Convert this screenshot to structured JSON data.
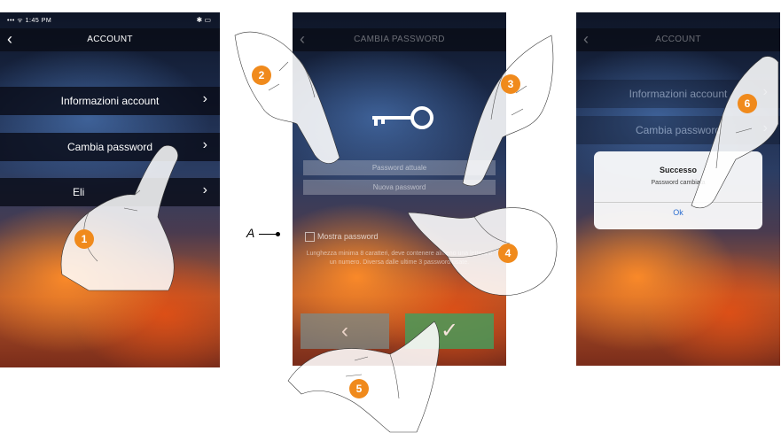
{
  "screen1": {
    "status_time": "1:45 PM",
    "status_left": "••• ᯤ",
    "status_right": "✱ ▭",
    "back_glyph": "‹",
    "title": "ACCOUNT",
    "rows": [
      {
        "label": "Informazioni account",
        "chevron": "›"
      },
      {
        "label": "Cambia password",
        "chevron": "›"
      },
      {
        "label": "Eli",
        "chevron": "›"
      }
    ]
  },
  "screen2": {
    "title": "CAMBIA PASSWORD",
    "back_glyph": "‹",
    "fields": [
      "Password attuale",
      "Nuova password"
    ],
    "show_password_label": "Mostra password",
    "help_text": "Lunghezza minima 8 caratteri, deve contenere almeno una lettera e un numero. Diversa dalle ultime 3 password usate.",
    "cancel_glyph": "‹",
    "confirm_glyph": "✓"
  },
  "screen3": {
    "title": "ACCOUNT",
    "back_glyph": "‹",
    "rows": [
      {
        "label": "Informazioni account",
        "chevron": "›"
      },
      {
        "label": "Cambia password",
        "chevron": "›"
      }
    ],
    "dialog": {
      "title": "Successo",
      "message": "Password cambiata",
      "ok": "Ok"
    }
  },
  "annotations": {
    "steps": [
      "1",
      "2",
      "3",
      "4",
      "5",
      "6"
    ],
    "marker_label": "A"
  },
  "colors": {
    "step_badge": "#f08a1c",
    "cancel_button": "#7d8a86",
    "confirm_button": "#4a9a5a"
  }
}
